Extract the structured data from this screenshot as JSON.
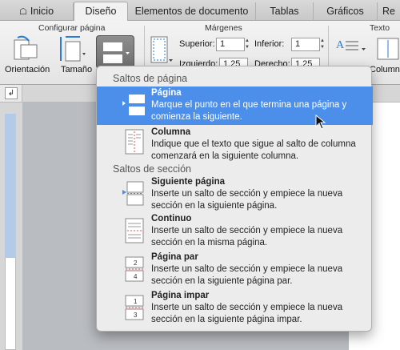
{
  "tabs": [
    "Inicio",
    "Diseño",
    "Elementos de documento",
    "Tablas",
    "Gráficos",
    "Re"
  ],
  "ribbon": {
    "group_config": "Configurar página",
    "group_margins": "Márgenes",
    "group_text": "Texto",
    "orientation_label": "Orientación",
    "size_label": "Tamaño",
    "superior_label": "Superior:",
    "superior_value": "1",
    "inferior_label": "Inferior:",
    "inferior_value": "1",
    "izquierdo_label": "Izquierdo:",
    "izquierdo_value": "1,25",
    "derecho_label": "Derecho:",
    "derecho_value": "1,25",
    "columns_label": "Columnas"
  },
  "menu": {
    "section_page": "Saltos de página",
    "section_section": "Saltos de sección",
    "items": [
      {
        "title": "Página",
        "desc": "Marque el punto en el que termina una página y comienza la siguiente.",
        "selected": true,
        "icon": "page-break-icon"
      },
      {
        "title": "Columna",
        "desc": "Indique que el texto que sigue al salto de columna comenzará en la siguiente columna.",
        "icon": "column-break-icon"
      },
      {
        "title": "Siguiente página",
        "desc": "Inserte un salto de sección y empiece la nueva sección en la siguiente página.",
        "icon": "next-page-break-icon"
      },
      {
        "title": "Continuo",
        "desc": "Inserte un salto de sección y empiece la nueva sección en la misma página.",
        "icon": "continuous-break-icon"
      },
      {
        "title": "Página par",
        "desc": "Inserte un salto de sección y empiece la nueva sección en la siguiente página par.",
        "icon": "even-page-break-icon"
      },
      {
        "title": "Página impar",
        "desc": "Inserte un salto de sección y empiece la nueva sección en la siguiente página impar.",
        "icon": "odd-page-break-icon"
      }
    ]
  },
  "icons": {
    "home": "home-icon",
    "breaks": "breaks-icon",
    "cursor": "mouse-pointer-icon"
  },
  "colors": {
    "accent": "#4b8fea",
    "ribbon": "#ececec"
  }
}
